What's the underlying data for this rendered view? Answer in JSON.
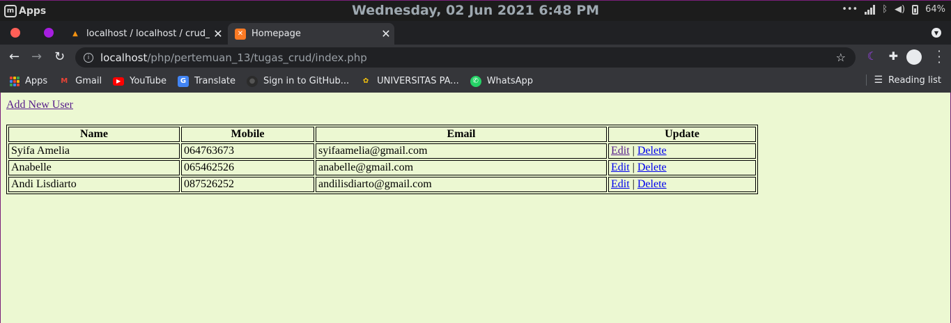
{
  "os_panel": {
    "apps_label": "Apps",
    "clock": "Wednesday, 02 Jun 2021  6:48 PM",
    "battery_percent": "64%"
  },
  "tabs": [
    {
      "title": "localhost / localhost / crud_db",
      "close": "✕"
    },
    {
      "title": "Homepage",
      "close": "✕"
    }
  ],
  "new_tab": "+",
  "address_bar": {
    "host": "localhost",
    "path": "/php/pertemuan_13/tugas_crud/index.php"
  },
  "bookmarks": [
    {
      "label": "Apps"
    },
    {
      "label": "Gmail"
    },
    {
      "label": "YouTube"
    },
    {
      "label": "Translate"
    },
    {
      "label": "Sign in to GitHub..."
    },
    {
      "label": "UNIVERSITAS PA..."
    },
    {
      "label": "WhatsApp"
    }
  ],
  "reading_list": "Reading list",
  "page": {
    "add_link": "Add New User",
    "headers": [
      "Name",
      "Mobile",
      "Email",
      "Update"
    ],
    "rows": [
      {
        "name": "Syifa Amelia",
        "mobile": "064763673",
        "email": "syifaamelia@gmail.com",
        "edit": "Edit",
        "sep": "|",
        "delete": "Delete"
      },
      {
        "name": "Anabelle",
        "mobile": "065462526",
        "email": "anabelle@gmail.com",
        "edit": "Edit",
        "sep": "|",
        "delete": "Delete"
      },
      {
        "name": "Andi Lisdiarto",
        "mobile": "087526252",
        "email": "andilisdiarto@gmail.com",
        "edit": "Edit",
        "sep": "|",
        "delete": "Delete"
      }
    ]
  },
  "colors": {
    "page_background": "#ecf8d2",
    "visited_link": "#551a8b",
    "link": "#0000ee"
  }
}
